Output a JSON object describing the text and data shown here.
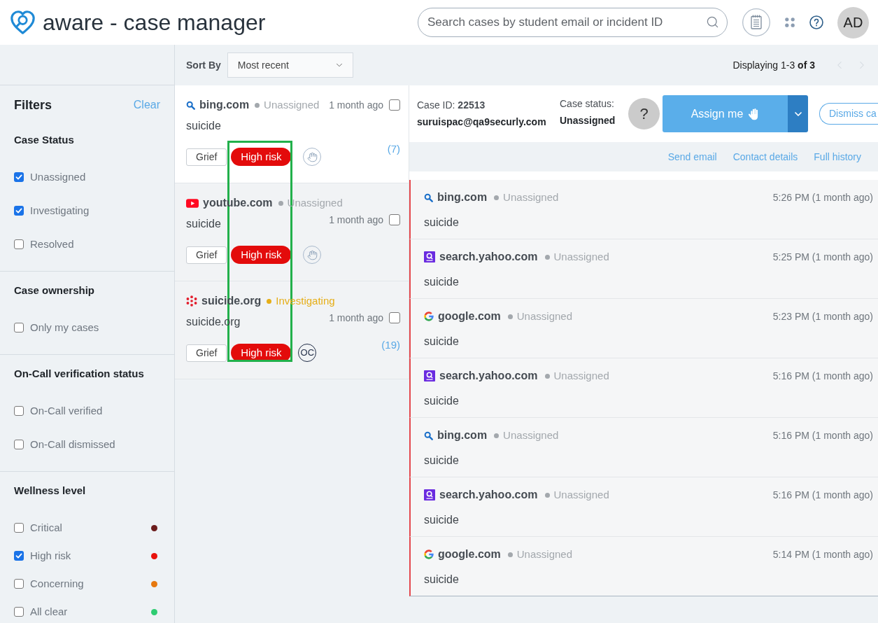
{
  "header": {
    "title": "aware - case manager",
    "search": {
      "placeholder": "Search cases by student email or incident ID"
    },
    "avatar": "AD"
  },
  "filters": {
    "title": "Filters",
    "clear": "Clear",
    "groups": [
      {
        "title": "Case Status",
        "options": [
          {
            "label": "Unassigned",
            "checked": true
          },
          {
            "label": "Investigating",
            "checked": true
          },
          {
            "label": "Resolved",
            "checked": false
          }
        ]
      },
      {
        "title": "Case ownership",
        "options": [
          {
            "label": "Only my cases",
            "checked": false
          }
        ]
      },
      {
        "title": "On-Call verification status",
        "options": [
          {
            "label": "On-Call verified",
            "checked": false
          },
          {
            "label": "On-Call dismissed",
            "checked": false
          }
        ]
      },
      {
        "title": "Wellness level",
        "options": [
          {
            "label": "Critical",
            "checked": false,
            "color": "#6b1c1c"
          },
          {
            "label": "High risk",
            "checked": true,
            "color": "#e8120c"
          },
          {
            "label": "Concerning",
            "checked": false,
            "color": "#e6780e"
          },
          {
            "label": "All clear",
            "checked": false,
            "color": "#2ecc71"
          }
        ]
      }
    ]
  },
  "case_list": {
    "sort": {
      "label": "Sort By",
      "value": "Most recent"
    },
    "cases": [
      {
        "kind": "bing",
        "site": "bing.com",
        "status": {
          "text": "Unassigned",
          "color": "#a3a8ad"
        },
        "time": "1 month ago",
        "checked": false,
        "snippet": "suicide",
        "category": "Grief",
        "risk": "High risk",
        "badge": {
          "kind": "hand"
        },
        "count": "(7)",
        "selected": true
      },
      {
        "kind": "youtube",
        "site": "youtube.com",
        "status": {
          "text": "Unassigned",
          "color": "#a3a8ad"
        },
        "time": "1 month ago",
        "checked": false,
        "snippet": "suicide",
        "category": "Grief",
        "risk": "High risk",
        "badge": {
          "kind": "hand"
        },
        "selected": false
      },
      {
        "kind": "flower",
        "site": "suicide.org",
        "status": {
          "text": "Investigating",
          "color": "#e6ae17"
        },
        "time": "1 month ago",
        "checked": false,
        "snippet": "suicide.org",
        "category": "Grief",
        "risk": "High risk",
        "badge": {
          "kind": "initials",
          "text": "OC"
        },
        "count": "(19)",
        "selected": false
      }
    ],
    "annotation": {
      "kind": "frame"
    }
  },
  "pagination": {
    "text": "Displaying 1-3 **of 3**",
    "previous": {
      "disabled": true
    },
    "next": {
      "disabled": true
    }
  },
  "case_detail": {
    "case_id": "Case ID: **22513**",
    "email": "suruispac@qa9securly.com",
    "status_label": "Case status:",
    "status": "Unassigned",
    "help": "?",
    "assign": "Assign me",
    "dismiss": "Dismiss ca",
    "links": [
      "Send email",
      "Contact details",
      "Full history"
    ]
  },
  "events": [
    {
      "kind": "bing",
      "site": "bing.com",
      "status": {
        "text": "Unassigned",
        "color": "#a3a8ad"
      },
      "time": "5:26 PM (1 month ago)",
      "snippet": "suicide"
    },
    {
      "kind": "yahoo",
      "site": "search.yahoo.com",
      "status": {
        "text": "Unassigned",
        "color": "#a3a8ad"
      },
      "time": "5:25 PM (1 month ago)",
      "snippet": "suicide"
    },
    {
      "kind": "google",
      "site": "google.com",
      "status": {
        "text": "Unassigned",
        "color": "#a3a8ad"
      },
      "time": "5:23 PM (1 month ago)",
      "snippet": "suicide"
    },
    {
      "kind": "yahoo",
      "site": "search.yahoo.com",
      "status": {
        "text": "Unassigned",
        "color": "#a3a8ad"
      },
      "time": "5:16 PM (1 month ago)",
      "snippet": "suicide"
    },
    {
      "kind": "bing",
      "site": "bing.com",
      "status": {
        "text": "Unassigned",
        "color": "#a3a8ad"
      },
      "time": "5:16 PM (1 month ago)",
      "snippet": "suicide"
    },
    {
      "kind": "yahoo",
      "site": "search.yahoo.com",
      "status": {
        "text": "Unassigned",
        "color": "#a3a8ad"
      },
      "time": "5:16 PM (1 month ago)",
      "snippet": "suicide"
    },
    {
      "kind": "google",
      "site": "google.com",
      "status": {
        "text": "Unassigned",
        "color": "#a3a8ad"
      },
      "time": "5:14 PM (1 month ago)",
      "snippet": "suicide"
    }
  ]
}
